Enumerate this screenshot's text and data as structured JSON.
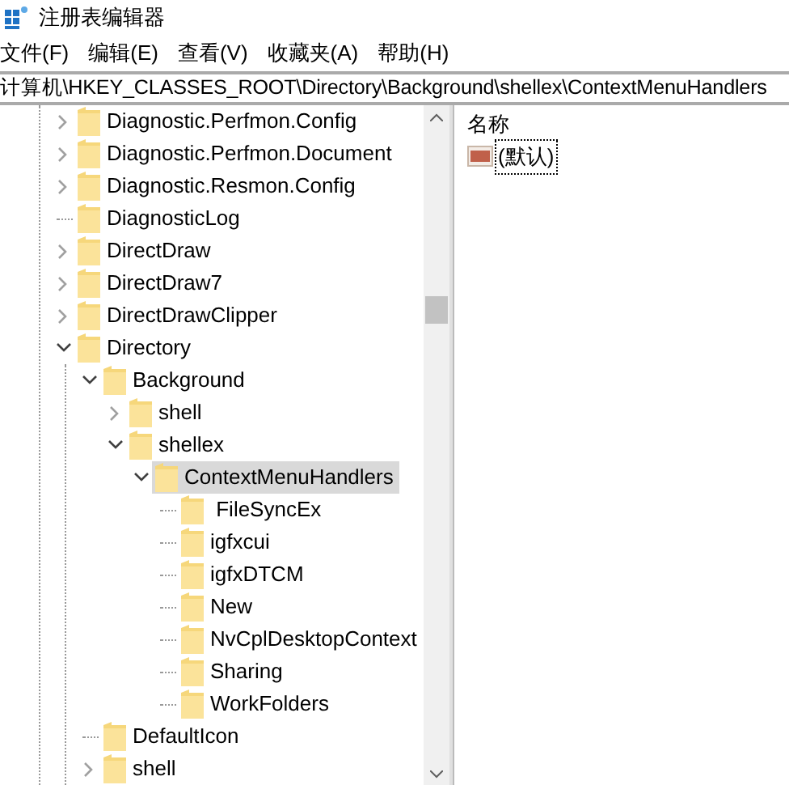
{
  "window": {
    "title": "注册表编辑器"
  },
  "menu": [
    "文件(F)",
    "编辑(E)",
    "查看(V)",
    "收藏夹(A)",
    "帮助(H)"
  ],
  "address": "计算机\\HKEY_CLASSES_ROOT\\Directory\\Background\\shellex\\ContextMenuHandlers",
  "tree": [
    {
      "name": "Diagnostic.Perfmon.Config",
      "kind": "folder",
      "expanded": false,
      "selected": false
    },
    {
      "name": "Diagnostic.Perfmon.Document",
      "kind": "folder",
      "expanded": false,
      "selected": false
    },
    {
      "name": "Diagnostic.Resmon.Config",
      "kind": "folder",
      "expanded": false,
      "selected": false
    },
    {
      "name": "DiagnosticLog",
      "kind": "leaf",
      "selected": false
    },
    {
      "name": "DirectDraw",
      "kind": "folder",
      "expanded": false,
      "selected": false
    },
    {
      "name": "DirectDraw7",
      "kind": "folder",
      "expanded": false,
      "selected": false
    },
    {
      "name": "DirectDrawClipper",
      "kind": "folder",
      "expanded": false,
      "selected": false
    },
    {
      "name": "Directory",
      "kind": "folder",
      "expanded": true,
      "selected": false,
      "children": [
        {
          "name": "Background",
          "kind": "folder",
          "expanded": true,
          "selected": false,
          "children": [
            {
              "name": "shell",
              "kind": "folder",
              "expanded": false,
              "selected": false
            },
            {
              "name": "shellex",
              "kind": "folder",
              "expanded": true,
              "selected": false,
              "children": [
                {
                  "name": "ContextMenuHandlers",
                  "kind": "folder",
                  "expanded": true,
                  "selected": true,
                  "children": [
                    {
                      "name": " FileSyncEx",
                      "kind": "leaf",
                      "selected": false
                    },
                    {
                      "name": "igfxcui",
                      "kind": "leaf",
                      "selected": false
                    },
                    {
                      "name": "igfxDTCM",
                      "kind": "leaf",
                      "selected": false
                    },
                    {
                      "name": "New",
                      "kind": "leaf",
                      "selected": false
                    },
                    {
                      "name": "NvCplDesktopContext",
                      "kind": "leaf",
                      "selected": false
                    },
                    {
                      "name": "Sharing",
                      "kind": "leaf",
                      "selected": false
                    },
                    {
                      "name": "WorkFolders",
                      "kind": "leaf",
                      "selected": false
                    }
                  ]
                }
              ]
            }
          ]
        },
        {
          "name": "DefaultIcon",
          "kind": "leaf",
          "selected": false
        },
        {
          "name": "shell",
          "kind": "folder",
          "expanded": false,
          "selected": false
        }
      ]
    }
  ],
  "values": {
    "columns": [
      "名称"
    ],
    "rows": [
      {
        "name": "(默认)",
        "focused": true
      }
    ]
  }
}
